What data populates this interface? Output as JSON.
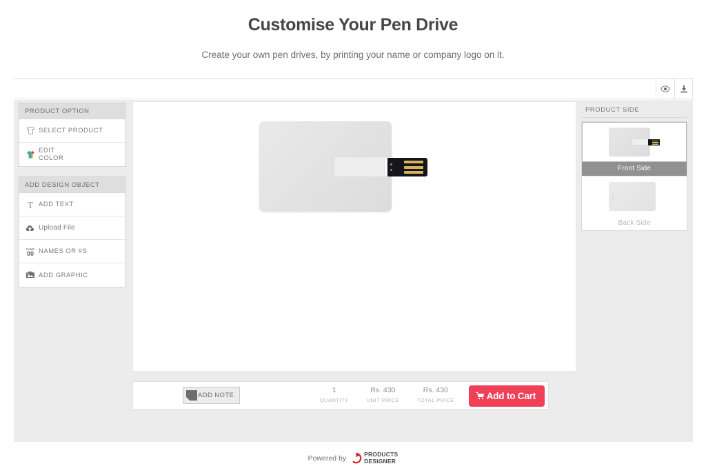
{
  "header": {
    "title": "Customise Your Pen Drive",
    "subtitle": "Create your own pen drives, by printing your name or company logo on it."
  },
  "toolbar": {
    "preview_icon": "eye-icon",
    "download_icon": "download-icon"
  },
  "sidebar": {
    "product_option": {
      "title": "PRODUCT OPTION",
      "items": [
        {
          "label": "SELECT PRODUCT",
          "icon": "tshirt-outline-icon"
        },
        {
          "label": "EDIT\nCOLOR",
          "icon": "tshirt-color-icon"
        }
      ]
    },
    "add_design_object": {
      "title": "ADD DESIGN OBJECT",
      "items": [
        {
          "label": "ADD TEXT",
          "icon": "text-t-icon"
        },
        {
          "label": "Upload File",
          "icon": "cloud-upload-icon"
        },
        {
          "label": "NAMES OR #S",
          "icon": "name-number-icon"
        },
        {
          "label": "ADD GRAPHIC",
          "icon": "image-graphic-icon"
        }
      ]
    }
  },
  "product_side": {
    "title": "PRODUCT SIDE",
    "items": [
      {
        "label": "Front Side",
        "selected": true
      },
      {
        "label": "Back Side",
        "selected": false
      }
    ]
  },
  "bottom_bar": {
    "note_label": "ADD NOTE",
    "note_icon": "note-icon",
    "quantity": {
      "value": "1",
      "label": "QUANTITY"
    },
    "unit_price": {
      "value": "Rs. 430",
      "label": "UNIT PRICE"
    },
    "total_price": {
      "value": "Rs. 430",
      "label": "TOTAL PRICE"
    },
    "cart_button": {
      "label": "Add to Cart",
      "icon": "cart-icon",
      "color": "#ef4058"
    }
  },
  "footer": {
    "powered_by": "Powered by",
    "brand_line1": "PRODUCTS",
    "brand_line2": "DESIGNER",
    "brand_color": "#cf2233"
  }
}
